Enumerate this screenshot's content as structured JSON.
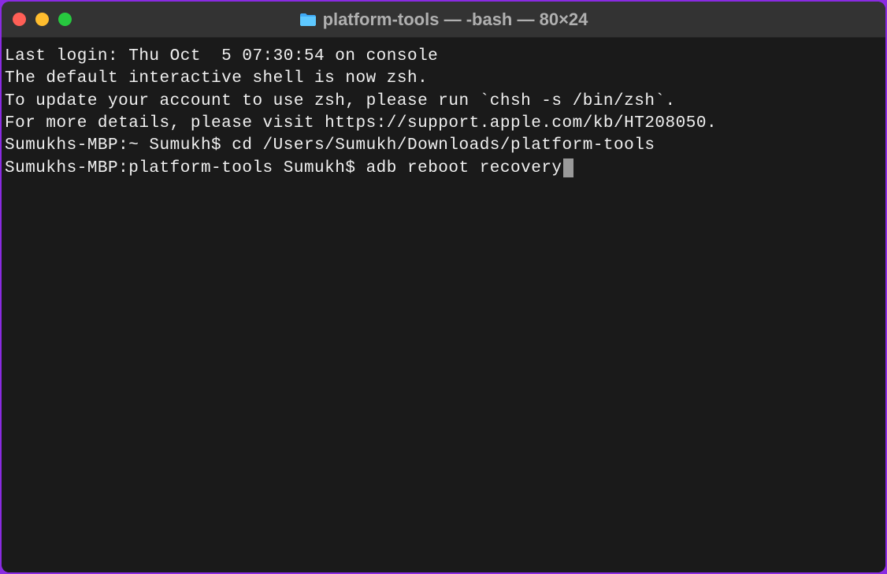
{
  "window": {
    "title": "platform-tools — -bash — 80×24"
  },
  "terminal": {
    "line1": "Last login: Thu Oct  5 07:30:54 on console",
    "line2": "",
    "line3": "The default interactive shell is now zsh.",
    "line4": "To update your account to use zsh, please run `chsh -s /bin/zsh`.",
    "line5": "For more details, please visit https://support.apple.com/kb/HT208050.",
    "prompt1_host": "Sumukhs-MBP:~ Sumukh$ ",
    "prompt1_cmd": "cd /Users/Sumukh/Downloads/platform-tools",
    "prompt2_host": "Sumukhs-MBP:platform-tools Sumukh$ ",
    "prompt2_cmd": "adb reboot recovery"
  }
}
